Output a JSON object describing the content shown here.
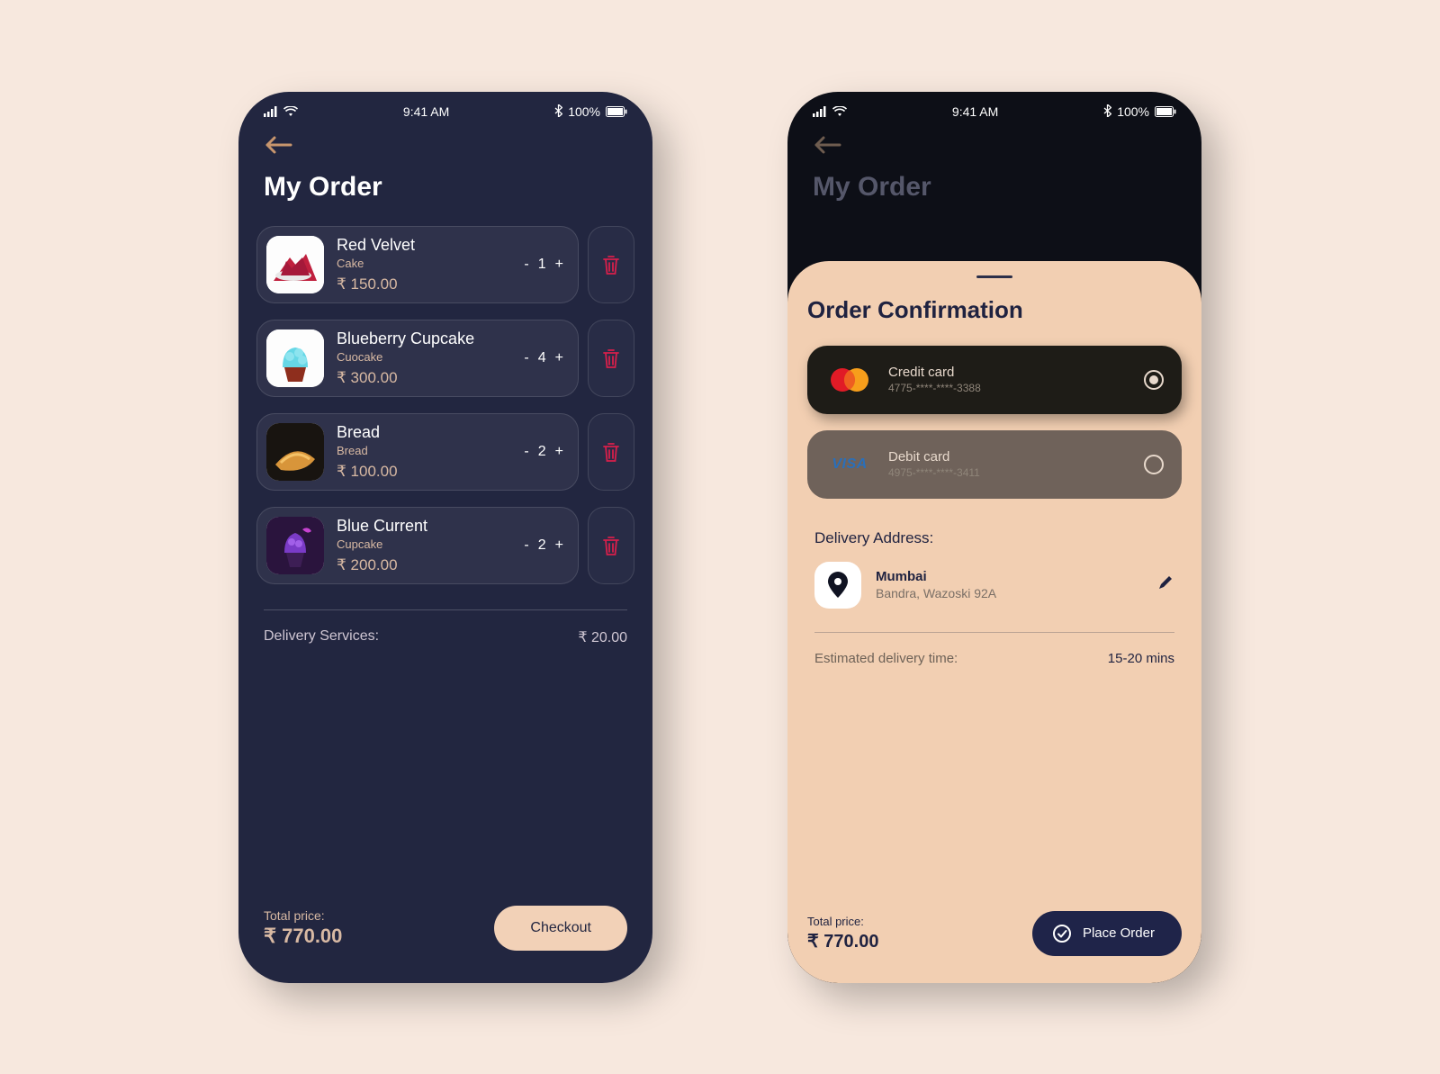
{
  "status": {
    "time": "9:41 AM",
    "battery_text": "100%"
  },
  "left": {
    "title": "My Order",
    "items": [
      {
        "name": "Red Velvet",
        "category": "Cake",
        "price": "₹ 150.00",
        "qty": "1"
      },
      {
        "name": "Blueberry Cupcake",
        "category": "Cuocake",
        "price": "₹ 300.00",
        "qty": "4"
      },
      {
        "name": "Bread",
        "category": "Bread",
        "price": "₹ 100.00",
        "qty": "2"
      },
      {
        "name": "Blue Current",
        "category": "Cupcake",
        "price": "₹ 200.00",
        "qty": "2"
      }
    ],
    "delivery_label": "Delivery Services:",
    "delivery_price": "₹ 20.00",
    "total_label": "Total price:",
    "total_amount": "₹ 770.00",
    "checkout": "Checkout"
  },
  "right": {
    "title_dim": "My Order",
    "sheet_title": "Order Confirmation",
    "payments": [
      {
        "type": "Credit card",
        "num": "4775-****-****-3388"
      },
      {
        "type": "Debit card",
        "num": "4975-****-****-3411"
      }
    ],
    "visa_text": "VISA",
    "address_heading": "Delivery Address:",
    "address": {
      "city": "Mumbai",
      "detail": "Bandra, Wazoski 92A"
    },
    "eta_label": "Estimated delivery time:",
    "eta_value": "15-20 mins",
    "total_label": "Total price:",
    "total_amount": "₹ 770.00",
    "place_order": "Place Order"
  }
}
